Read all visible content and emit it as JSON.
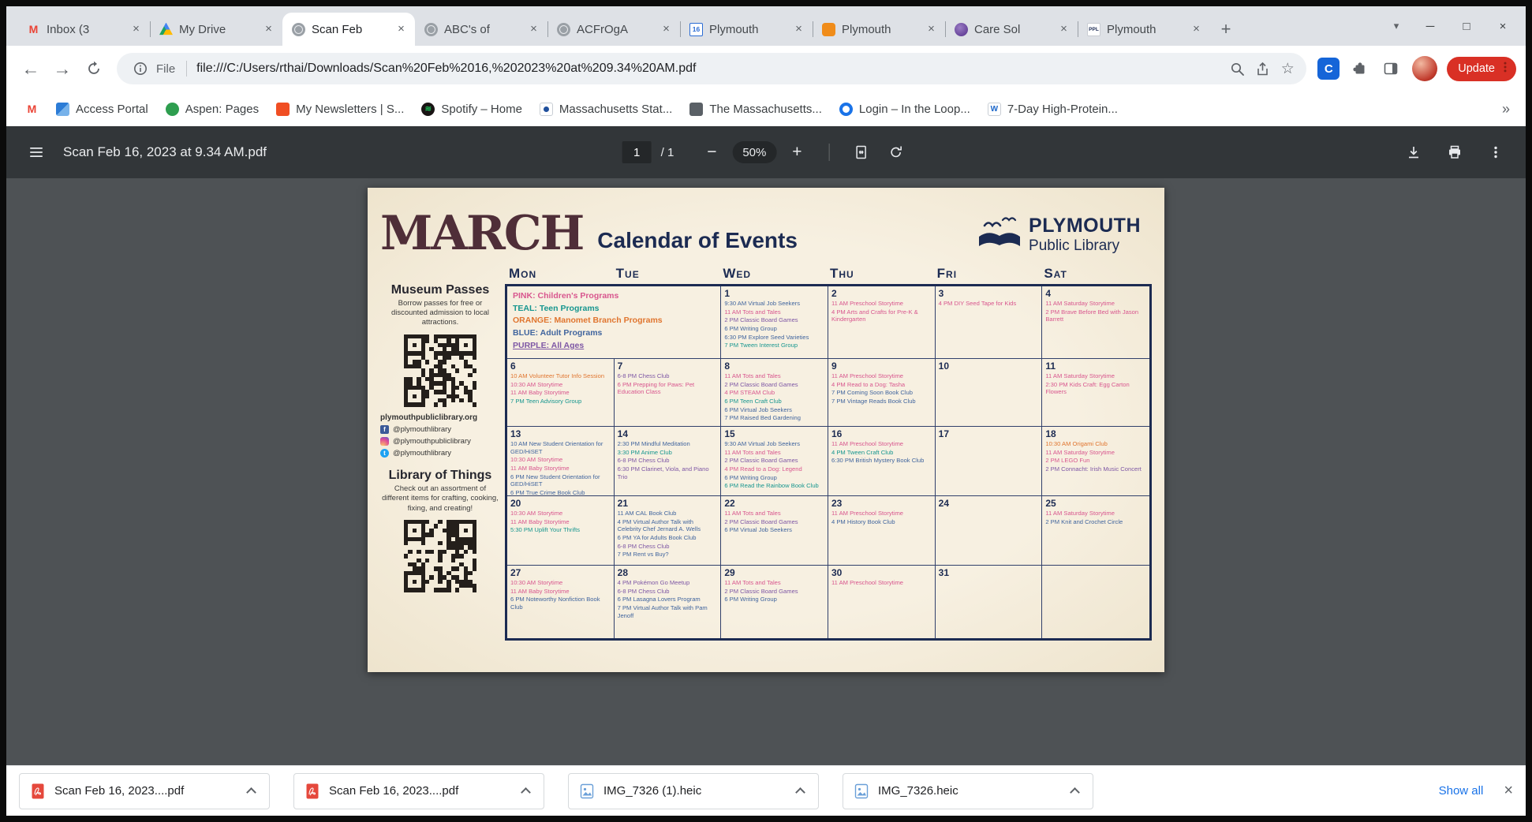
{
  "browser": {
    "update_label": "Update",
    "update_color": "#d93025",
    "address": {
      "scheme_label": "File",
      "url": "file:///C:/Users/rthai/Downloads/Scan%20Feb%2016,%202023%20at%209.34%20AM.pdf"
    },
    "tabs": [
      {
        "title": "Inbox (3",
        "icon": "gmail",
        "active": false
      },
      {
        "title": "My Drive",
        "icon": "drive",
        "active": false
      },
      {
        "title": "Scan Feb",
        "icon": "globe",
        "active": true
      },
      {
        "title": "ABC's of",
        "icon": "globe",
        "active": false
      },
      {
        "title": "ACFrOgA",
        "icon": "globe",
        "active": false
      },
      {
        "title": "Plymouth",
        "icon": "cal16",
        "active": false
      },
      {
        "title": "Plymouth",
        "icon": "doc-orange",
        "active": false
      },
      {
        "title": "Care Sol",
        "icon": "care",
        "active": false
      },
      {
        "title": "Plymouth",
        "icon": "ppl",
        "active": false
      }
    ],
    "bookmarks": [
      {
        "label": "",
        "icon": "gmail"
      },
      {
        "label": "Access Portal",
        "icon": "portal"
      },
      {
        "label": "Aspen: Pages",
        "icon": "aspen"
      },
      {
        "label": "My Newsletters | S...",
        "icon": "newsletter"
      },
      {
        "label": "Spotify – Home",
        "icon": "spotify"
      },
      {
        "label": "Massachusetts Stat...",
        "icon": "mass-flag"
      },
      {
        "label": "The Massachusetts...",
        "icon": "mass-news"
      },
      {
        "label": "Login – In the Loop...",
        "icon": "loop"
      },
      {
        "label": "7-Day High-Protein...",
        "icon": "webmd"
      }
    ]
  },
  "pdfbar": {
    "title": "Scan Feb 16, 2023 at 9.34 AM.pdf",
    "page": "1",
    "page_total": "/ 1",
    "zoom": "50%"
  },
  "document": {
    "month": "MARCH",
    "subtitle": "Calendar of Events",
    "logo": {
      "line1": "PLYMOUTH",
      "line2": "Public Library"
    },
    "sidebar": {
      "museum_title": "Museum Passes",
      "museum_body": "Borrow passes for free or discounted admission to local attractions.",
      "website": "plymouthpubliclibrary.org",
      "socials": [
        {
          "icon": "facebook",
          "handle": "@plymouthlibrary"
        },
        {
          "icon": "instagram",
          "handle": "@plymouthpubliclibrary"
        },
        {
          "icon": "twitter",
          "handle": "@plymouthlibrary"
        }
      ],
      "lot_title": "Library of Things",
      "lot_body": "Check out an assortment of different items for crafting, cooking, fixing, and creating!"
    },
    "calendar": {
      "weekday_headers": [
        "Mon",
        "Tue",
        "Wed",
        "Thu",
        "Fri",
        "Sat"
      ],
      "colors": {
        "pink": "#d8568e",
        "teal": "#17968f",
        "orange": "#e0752f",
        "blue": "#41659e",
        "purple": "#7e57a5"
      },
      "legend": [
        {
          "label": "PINK: Children's Programs",
          "color": "pink"
        },
        {
          "label": "TEAL: Teen Programs",
          "color": "teal"
        },
        {
          "label": "ORANGE: Manomet Branch Programs",
          "color": "orange"
        },
        {
          "label": "BLUE: Adult Programs",
          "color": "blue"
        },
        {
          "label": "PURPLE: All Ages",
          "color": "purple",
          "underline": true
        }
      ],
      "weeks": [
        {
          "cells": [
            {
              "type": "legend"
            },
            {
              "day": "1",
              "events": [
                {
                  "t": "9:30 AM Virtual Job Seekers",
                  "c": "blue"
                },
                {
                  "t": "11 AM Tots and Tales",
                  "c": "pink"
                },
                {
                  "t": "2 PM Classic Board Games",
                  "c": "purple"
                },
                {
                  "t": "6 PM Writing Group",
                  "c": "blue"
                },
                {
                  "t": "6:30 PM Explore Seed Varieties",
                  "c": "blue"
                },
                {
                  "t": "7 PM Tween Interest Group",
                  "c": "teal"
                }
              ]
            },
            {
              "day": "2",
              "events": [
                {
                  "t": "11 AM Preschool Storytime",
                  "c": "pink"
                },
                {
                  "t": "4 PM Arts and Crafts for Pre-K & Kindergarten",
                  "c": "pink"
                }
              ]
            },
            {
              "day": "3",
              "events": [
                {
                  "t": "4 PM DIY Seed Tape for Kids",
                  "c": "pink"
                }
              ]
            },
            {
              "day": "4",
              "events": [
                {
                  "t": "11 AM Saturday Storytime",
                  "c": "pink"
                },
                {
                  "t": "2 PM Brave Before Bed with Jason Barrett",
                  "c": "pink"
                }
              ]
            }
          ]
        },
        {
          "cells": [
            {
              "day": "6",
              "events": [
                {
                  "t": "10 AM Volunteer Tutor Info Session",
                  "c": "orange"
                },
                {
                  "t": "10:30 AM Storytime",
                  "c": "pink"
                },
                {
                  "t": "11 AM Baby Storytime",
                  "c": "pink"
                },
                {
                  "t": "7 PM Teen Advisory Group",
                  "c": "teal"
                }
              ]
            },
            {
              "day": "7",
              "events": [
                {
                  "t": "6-8 PM Chess Club",
                  "c": "purple"
                },
                {
                  "t": "6 PM Prepping for Paws: Pet Education Class",
                  "c": "pink"
                }
              ]
            },
            {
              "day": "8",
              "events": [
                {
                  "t": "11 AM Tots and Tales",
                  "c": "pink"
                },
                {
                  "t": "2 PM Classic Board Games",
                  "c": "purple"
                },
                {
                  "t": "4 PM STEAM Club",
                  "c": "pink"
                },
                {
                  "t": "6 PM Teen Craft Club",
                  "c": "teal"
                },
                {
                  "t": "6 PM Virtual Job Seekers",
                  "c": "blue"
                },
                {
                  "t": "7 PM Raised Bed Gardening",
                  "c": "blue"
                }
              ]
            },
            {
              "day": "9",
              "events": [
                {
                  "t": "11 AM Preschool Storytime",
                  "c": "pink"
                },
                {
                  "t": "4 PM Read to a Dog: Tasha",
                  "c": "pink"
                },
                {
                  "t": "7 PM Coming Soon Book Club",
                  "c": "blue"
                },
                {
                  "t": "7 PM Vintage Reads Book Club",
                  "c": "blue"
                }
              ]
            },
            {
              "day": "10",
              "events": []
            },
            {
              "day": "11",
              "events": [
                {
                  "t": "11 AM Saturday Storytime",
                  "c": "pink"
                },
                {
                  "t": "2:30 PM Kids Craft: Egg Carton Flowers",
                  "c": "pink"
                }
              ]
            }
          ]
        },
        {
          "cells": [
            {
              "day": "13",
              "events": [
                {
                  "t": "10 AM New Student Orientation for GED/HiSET",
                  "c": "blue"
                },
                {
                  "t": "10:30 AM Storytime",
                  "c": "pink"
                },
                {
                  "t": "11 AM Baby Storytime",
                  "c": "pink"
                },
                {
                  "t": "6 PM New Student Orientation for GED/HiSET",
                  "c": "blue"
                },
                {
                  "t": "6 PM True Crime Book Club",
                  "c": "blue"
                }
              ]
            },
            {
              "day": "14",
              "events": [
                {
                  "t": "2:30 PM Mindful Meditation",
                  "c": "blue"
                },
                {
                  "t": "3:30 PM Anime Club",
                  "c": "teal"
                },
                {
                  "t": "6-8 PM Chess Club",
                  "c": "purple"
                },
                {
                  "t": "6:30 PM Clarinet, Viola, and Piano Trio",
                  "c": "purple"
                }
              ]
            },
            {
              "day": "15",
              "events": [
                {
                  "t": "9:30 AM Virtual Job Seekers",
                  "c": "blue"
                },
                {
                  "t": "11 AM Tots and Tales",
                  "c": "pink"
                },
                {
                  "t": "2 PM Classic Board Games",
                  "c": "purple"
                },
                {
                  "t": "4 PM Read to a Dog: Legend",
                  "c": "pink"
                },
                {
                  "t": "6 PM Writing Group",
                  "c": "blue"
                },
                {
                  "t": "6 PM Read the Rainbow Book Club",
                  "c": "teal"
                }
              ]
            },
            {
              "day": "16",
              "events": [
                {
                  "t": "11 AM Preschool Storytime",
                  "c": "pink"
                },
                {
                  "t": "4 PM Tween Craft Club",
                  "c": "teal"
                },
                {
                  "t": "6:30 PM British Mystery Book Club",
                  "c": "blue"
                }
              ]
            },
            {
              "day": "17",
              "events": []
            },
            {
              "day": "18",
              "events": [
                {
                  "t": "10:30 AM Origami Club",
                  "c": "orange"
                },
                {
                  "t": "11 AM Saturday Storytime",
                  "c": "pink"
                },
                {
                  "t": "2 PM LEGO Fun",
                  "c": "pink"
                },
                {
                  "t": "2 PM Connacht: Irish Music Concert",
                  "c": "purple"
                }
              ]
            }
          ]
        },
        {
          "cells": [
            {
              "day": "20",
              "events": [
                {
                  "t": "10:30 AM Storytime",
                  "c": "pink"
                },
                {
                  "t": "11 AM Baby Storytime",
                  "c": "pink"
                },
                {
                  "t": "5:30 PM Uplift Your Thrifts",
                  "c": "teal"
                }
              ]
            },
            {
              "day": "21",
              "events": [
                {
                  "t": "11 AM CAL Book Club",
                  "c": "blue"
                },
                {
                  "t": "4 PM Virtual Author Talk with Celebrity Chef Jernard A. Wells",
                  "c": "blue"
                },
                {
                  "t": "6 PM YA for Adults Book Club",
                  "c": "blue"
                },
                {
                  "t": "6-8 PM Chess Club",
                  "c": "purple"
                },
                {
                  "t": "7 PM Rent vs Buy?",
                  "c": "blue"
                }
              ]
            },
            {
              "day": "22",
              "events": [
                {
                  "t": "11 AM Tots and Tales",
                  "c": "pink"
                },
                {
                  "t": "2 PM Classic Board Games",
                  "c": "purple"
                },
                {
                  "t": "6 PM Virtual Job Seekers",
                  "c": "blue"
                }
              ]
            },
            {
              "day": "23",
              "events": [
                {
                  "t": "11 AM Preschool Storytime",
                  "c": "pink"
                },
                {
                  "t": "4 PM History Book Club",
                  "c": "blue"
                }
              ]
            },
            {
              "day": "24",
              "events": []
            },
            {
              "day": "25",
              "events": [
                {
                  "t": "11 AM Saturday Storytime",
                  "c": "pink"
                },
                {
                  "t": "2 PM Knit and Crochet Circle",
                  "c": "blue"
                }
              ]
            }
          ]
        },
        {
          "cells": [
            {
              "day": "27",
              "events": [
                {
                  "t": "10:30 AM Storytime",
                  "c": "pink"
                },
                {
                  "t": "11 AM Baby Storytime",
                  "c": "pink"
                },
                {
                  "t": "6 PM Noteworthy Nonfiction Book Club",
                  "c": "blue"
                }
              ]
            },
            {
              "day": "28",
              "events": [
                {
                  "t": "4 PM Pokémon Go Meetup",
                  "c": "purple"
                },
                {
                  "t": "6-8 PM Chess Club",
                  "c": "purple"
                },
                {
                  "t": "6 PM Lasagna Lovers Program",
                  "c": "blue"
                },
                {
                  "t": "7 PM Virtual Author Talk with Pam Jenoff",
                  "c": "blue"
                }
              ]
            },
            {
              "day": "29",
              "events": [
                {
                  "t": "11 AM Tots and Tales",
                  "c": "pink"
                },
                {
                  "t": "2 PM Classic Board Games",
                  "c": "purple"
                },
                {
                  "t": "6 PM Writing Group",
                  "c": "blue"
                }
              ]
            },
            {
              "day": "30",
              "events": [
                {
                  "t": "11 AM Preschool Storytime",
                  "c": "pink"
                }
              ]
            },
            {
              "day": "31",
              "events": []
            },
            {
              "day": "",
              "events": []
            }
          ]
        }
      ]
    }
  },
  "downloads": {
    "link_color": "#1a73e8",
    "show_all": "Show all",
    "items": [
      {
        "name": "Scan Feb 16, 2023....pdf",
        "kind": "pdf"
      },
      {
        "name": "Scan Feb 16, 2023....pdf",
        "kind": "pdf"
      },
      {
        "name": "IMG_7326 (1).heic",
        "kind": "image"
      },
      {
        "name": "IMG_7326.heic",
        "kind": "image"
      }
    ]
  }
}
